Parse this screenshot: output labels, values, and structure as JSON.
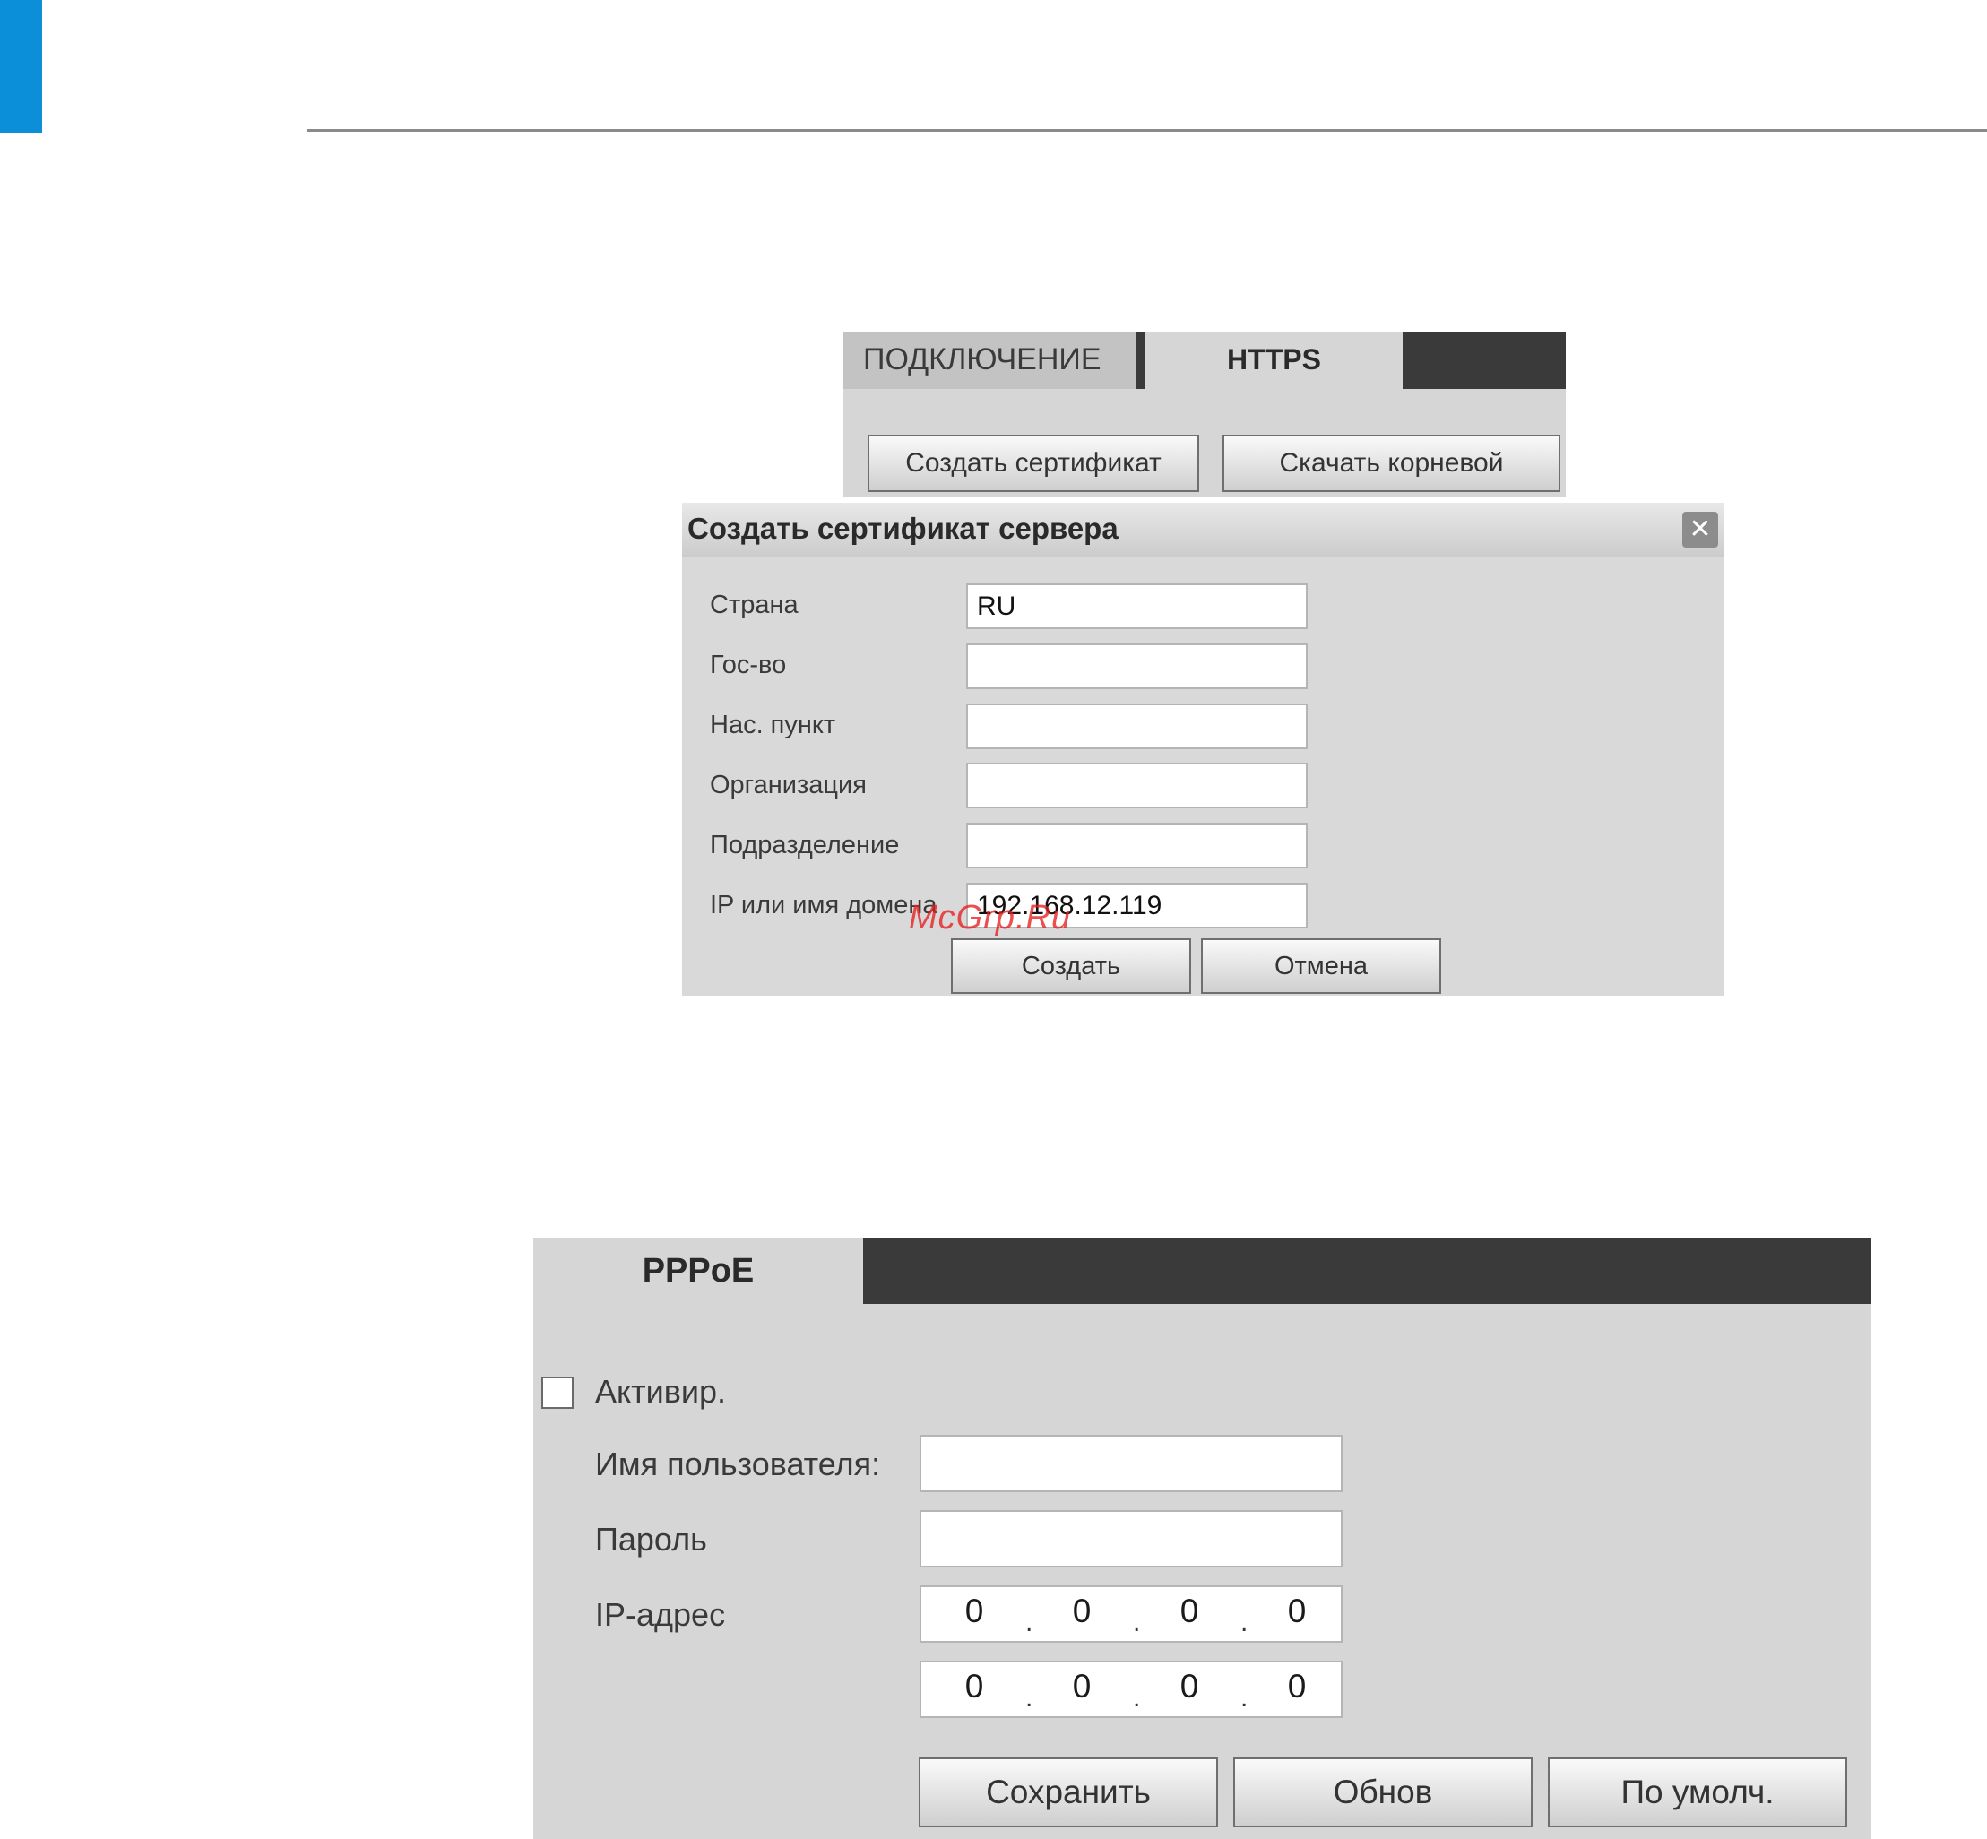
{
  "https_panel": {
    "tabs": [
      "ПОДКЛЮЧЕНИЕ",
      "HTTPS"
    ],
    "active_tab": "HTTPS",
    "create_cert_label": "Создать сертификат",
    "download_root_label": "Скачать корневой"
  },
  "cert_dialog": {
    "title": "Создать сертификат сервера",
    "close_glyph": "✕",
    "fields": [
      {
        "label": "Страна",
        "value": "RU"
      },
      {
        "label": "Гос-во",
        "value": ""
      },
      {
        "label": "Нас. пункт",
        "value": ""
      },
      {
        "label": "Организация",
        "value": ""
      },
      {
        "label": "Подразделение",
        "value": ""
      },
      {
        "label": "IP или имя домена",
        "value": "192.168.12.119"
      }
    ],
    "create_label": "Создать",
    "cancel_label": "Отмена"
  },
  "watermark": "McGrp.Ru",
  "pppoe_panel": {
    "tab": "PPPoE",
    "enable_label": "Активир.",
    "enable_checked": false,
    "username_label": "Имя пользователя:",
    "username_value": "",
    "password_label": "Пароль",
    "password_value": "",
    "ip_label": "IP-адрес",
    "ip_rows": [
      [
        "0",
        "0",
        "0",
        "0"
      ],
      [
        "0",
        "0",
        "0",
        "0"
      ]
    ],
    "save_label": "Сохранить",
    "refresh_label": "Обнов",
    "default_label": "По умолч."
  },
  "colors": {
    "accent": "#0a8fd8",
    "panel_bg": "#d6d6d6",
    "dark_tab": "#3a3a3a",
    "watermark": "#e61e1e"
  }
}
